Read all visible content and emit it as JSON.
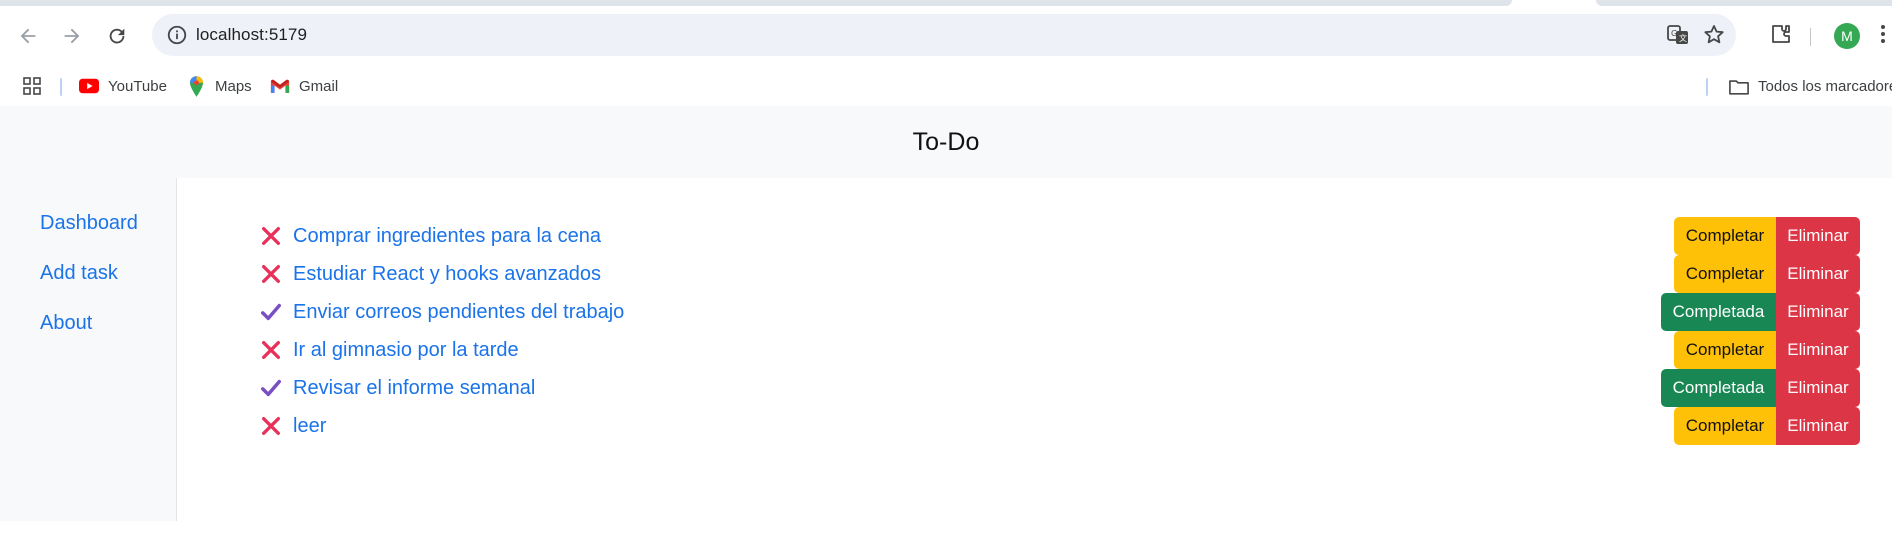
{
  "browser": {
    "url": "localhost:5179",
    "avatar_letter": "M",
    "bookmarks": [
      {
        "label": "YouTube",
        "icon": "youtube-icon"
      },
      {
        "label": "Maps",
        "icon": "maps-icon"
      },
      {
        "label": "Gmail",
        "icon": "gmail-icon"
      }
    ],
    "all_bookmarks_label": "Todos los marcadores"
  },
  "app": {
    "title": "To-Do",
    "nav": [
      {
        "label": "Dashboard"
      },
      {
        "label": "Add task"
      },
      {
        "label": "About"
      }
    ],
    "tasks": [
      {
        "text": "Comprar ingredientes para la cena",
        "done": false,
        "status_label": "Completar",
        "delete_label": "Eliminar"
      },
      {
        "text": "Estudiar React y hooks avanzados",
        "done": false,
        "status_label": "Completar",
        "delete_label": "Eliminar"
      },
      {
        "text": "Enviar correos pendientes del trabajo",
        "done": true,
        "status_label": "Completada",
        "delete_label": "Eliminar"
      },
      {
        "text": "Ir al gimnasio por la tarde",
        "done": false,
        "status_label": "Completar",
        "delete_label": "Eliminar"
      },
      {
        "text": "Revisar el informe semanal",
        "done": true,
        "status_label": "Completada",
        "delete_label": "Eliminar"
      },
      {
        "text": "leer",
        "done": false,
        "status_label": "Completar",
        "delete_label": "Eliminar"
      }
    ]
  },
  "colors": {
    "link": "#1a73e8",
    "warning": "#ffc107",
    "success": "#198754",
    "danger": "#dc3545",
    "cross": "#e8315a",
    "check": "#7b4fc4"
  }
}
